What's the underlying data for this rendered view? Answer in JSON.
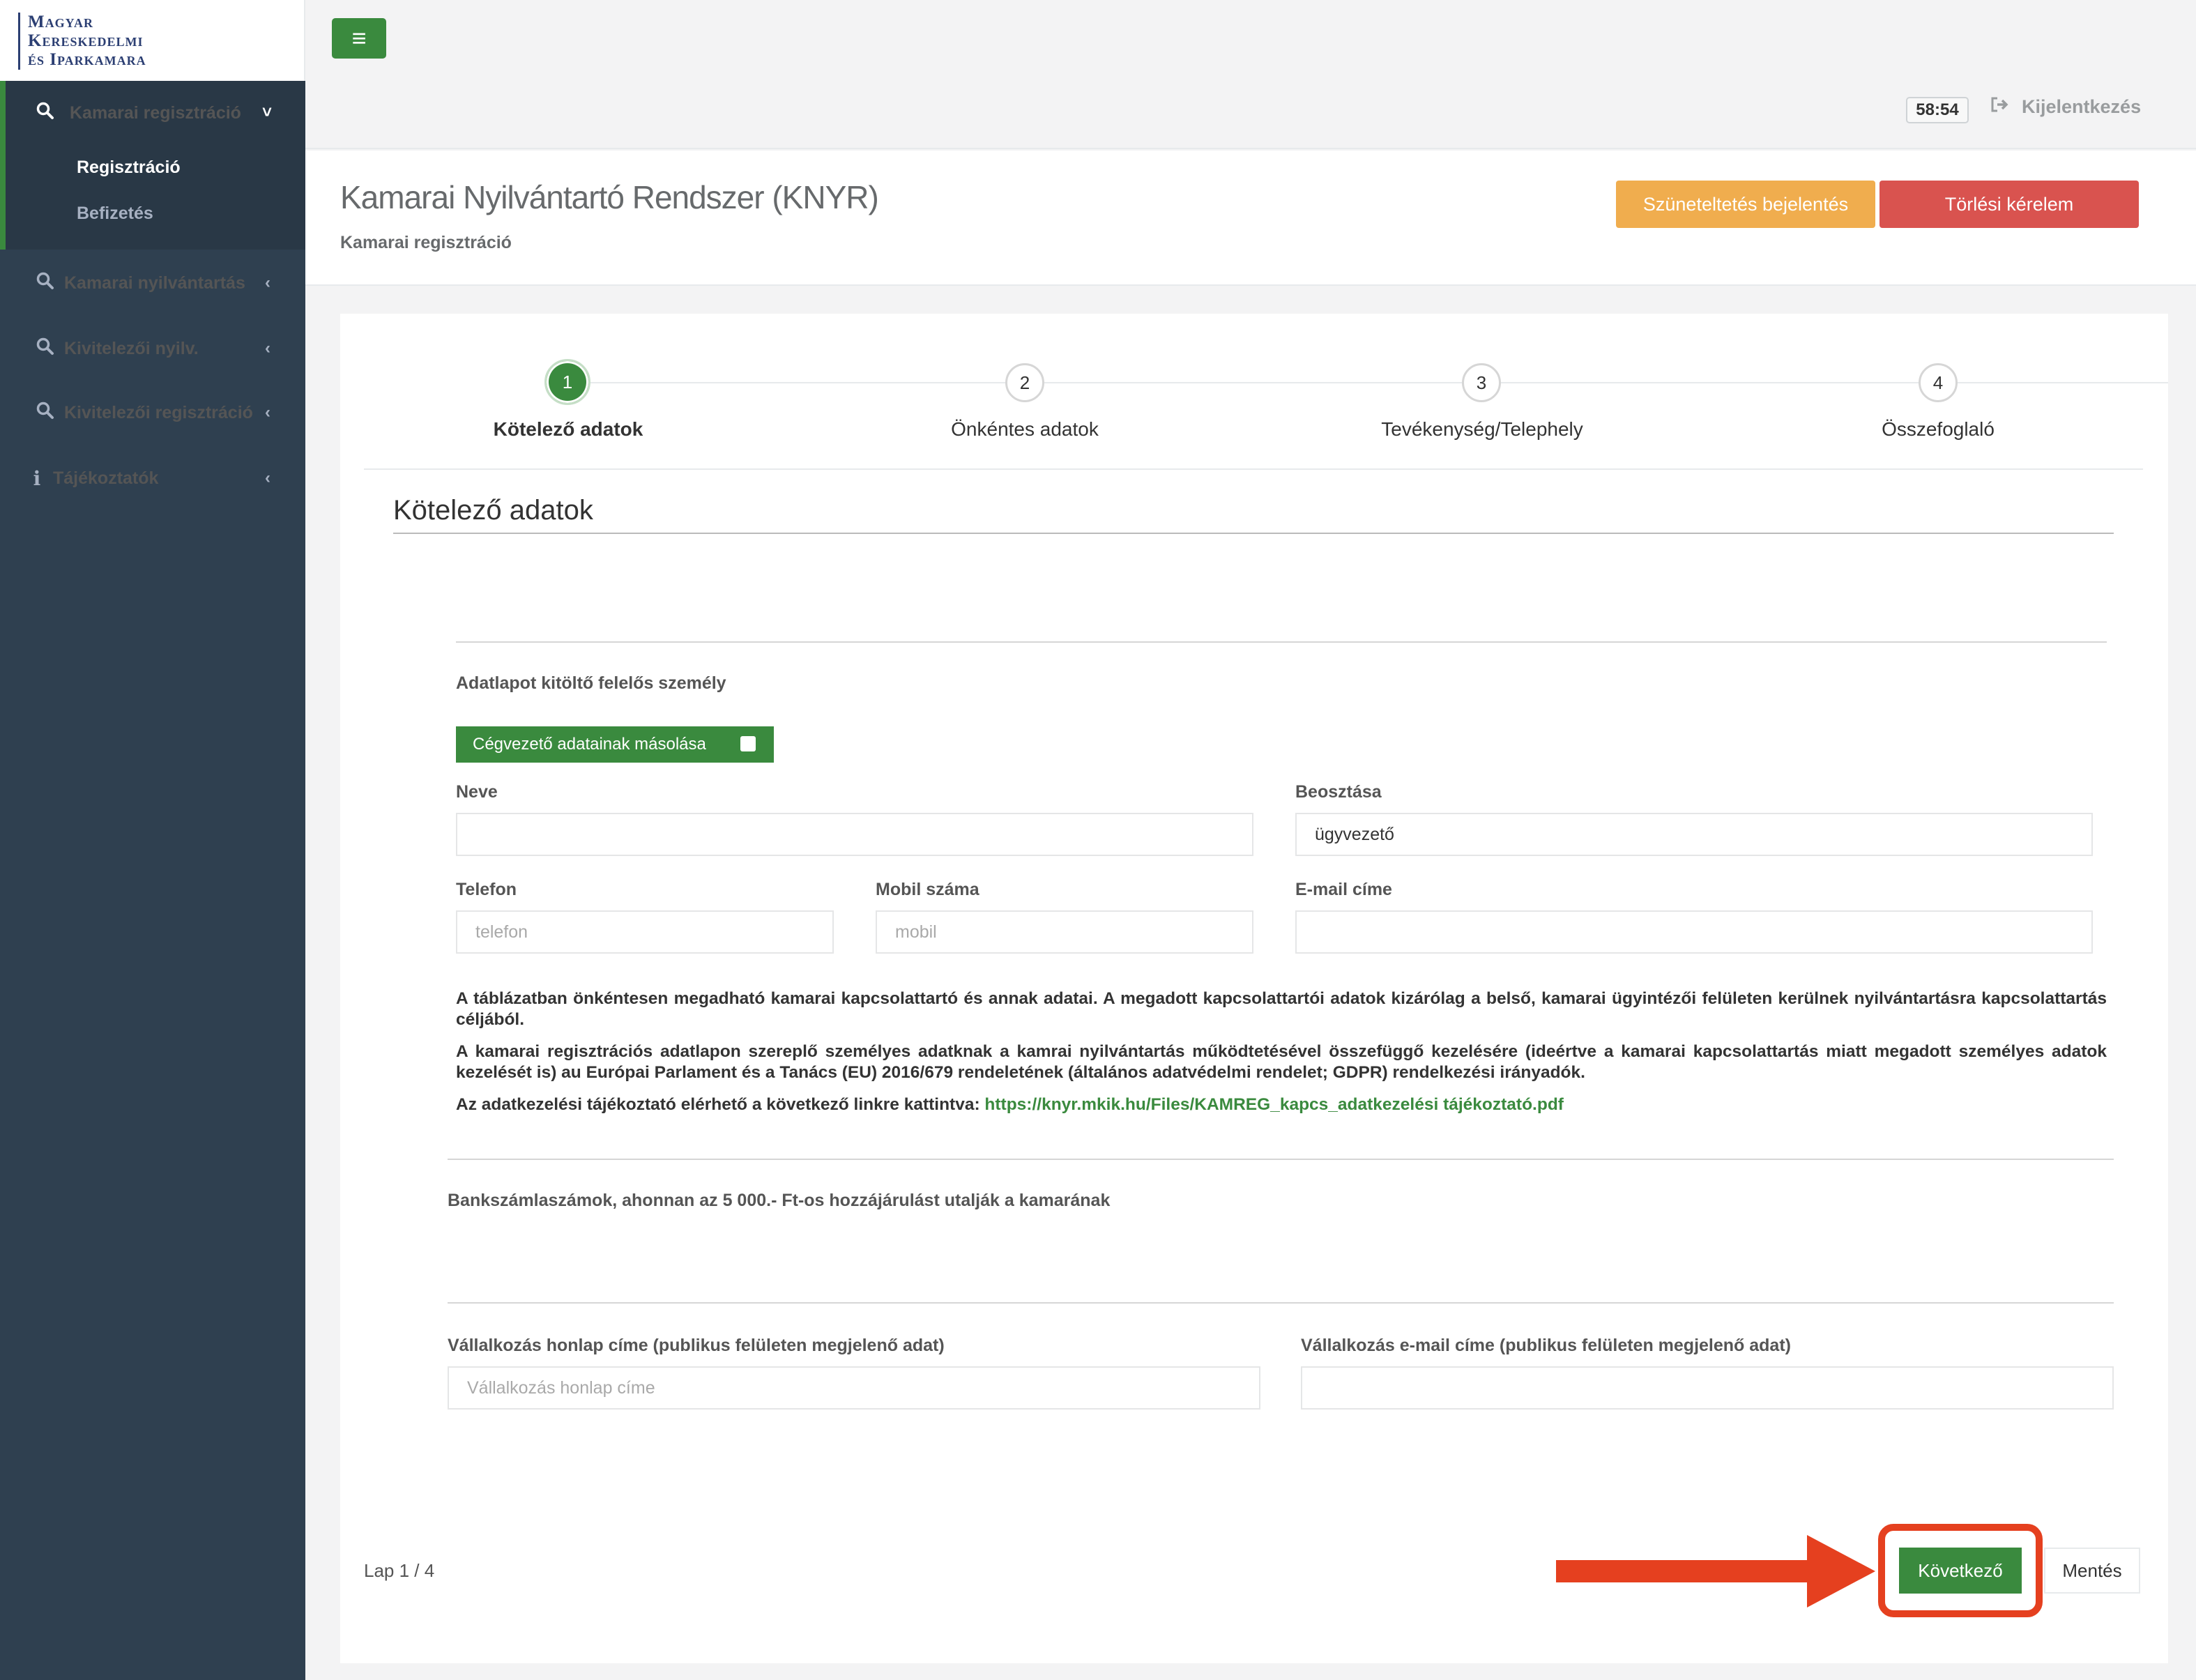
{
  "logo": {
    "lines": [
      "Magyar",
      "Kereskedelmi",
      "és Iparkamara"
    ]
  },
  "sidebar": {
    "items": [
      {
        "label": "Kamarai regisztráció",
        "icon": "search-icon",
        "expanded": true,
        "children": [
          {
            "label": "Regisztráció",
            "active": true
          },
          {
            "label": "Befizetés",
            "active": false
          }
        ]
      },
      {
        "label": "Kamarai nyilvántartás",
        "icon": "search-icon"
      },
      {
        "label": "Kivitelezői nyilv.",
        "icon": "search-icon"
      },
      {
        "label": "Kivitelezői regisztráció",
        "icon": "search-icon"
      },
      {
        "label": "Tájékoztatók",
        "icon": "info-icon"
      }
    ]
  },
  "topbar": {
    "menu_glyph": "≡",
    "timer": "58:54",
    "logout_label": "Kijelentkezés"
  },
  "heading": {
    "title": "Kamarai Nyilvántartó Rendszer (KNYR)",
    "breadcrumb": "Kamarai regisztráció",
    "suspend_button": "Szüneteltetés bejelentés",
    "delete_button": "Törlési kérelem"
  },
  "steps": [
    {
      "number": "1",
      "label": "Kötelező adatok",
      "active": true
    },
    {
      "number": "2",
      "label": "Önkéntes adatok",
      "active": false
    },
    {
      "number": "3",
      "label": "Tevékenység/Telephely",
      "active": false
    },
    {
      "number": "4",
      "label": "Összefoglaló",
      "active": false
    }
  ],
  "form": {
    "section_title": "Kötelező adatok",
    "responsible_heading": "Adatlapot kitöltő felelős személy",
    "copy_button": "Cégvezető adatainak másolása",
    "name_label": "Neve",
    "name_value": "",
    "position_label": "Beosztása",
    "position_value": "ügyvezető",
    "phone_label": "Telefon",
    "phone_placeholder": "telefon",
    "mobile_label": "Mobil száma",
    "mobile_placeholder": "mobil",
    "email_label": "E-mail címe",
    "email_value": "",
    "para1": "A táblázatban önkéntesen megadható  kamarai kapcsolattartó és annak adatai. A megadott kapcsolattartói adatok kizárólag a belső, kamarai ügyintézői felületen kerülnek nyilvántartásra kapcsolattartás céljából.",
    "para2": "A kamarai regisztrációs adatlapon szereplő személyes adatknak a kamrai nyilvántartás működtetésével összefüggő kezelésére (ideértve a kamarai kapcsolattartás miatt megadott személyes adatok kezelését is) au Európai Parlament és a Tanács (EU) 2016/679 rendeletének (általános adatvédelmi rendelet; GDPR) rendelkezési irányadók.",
    "para3_prefix": "Az adatkezelési tájékoztató elérhető a következő linkre kattintva: ",
    "para3_link": "https://knyr.mkik.hu/Files/KAMREG_kapcs_adatkezelési tájékoztató.pdf",
    "bank_heading": "Bankszámlaszámok, ahonnan az 5 000.- Ft-os hozzájárulást utalják a kamarának",
    "website_label": "Vállalkozás honlap címe (publikus felületen megjelenő adat)",
    "website_placeholder": "Vállalkozás honlap címe",
    "company_email_label": "Vállalkozás e-mail címe (publikus felületen megjelenő adat)",
    "company_email_value": ""
  },
  "footer": {
    "page_indicator": "Lap 1 / 4",
    "next_button": "Következő",
    "save_button": "Mentés"
  },
  "colors": {
    "primary": "#3a8a3e",
    "sidebar": "#2f4050",
    "warning": "#f0ad4e",
    "danger": "#d9534f",
    "annotation": "#e5401f"
  }
}
